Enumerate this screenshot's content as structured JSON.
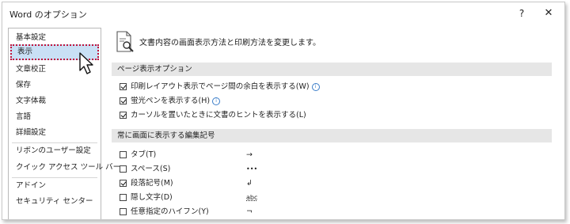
{
  "window": {
    "title": "Word のオプション",
    "help_glyph": "?",
    "close_glyph": "✕"
  },
  "sidebar": {
    "items": [
      {
        "label": "基本設定"
      },
      {
        "label": "表示",
        "selected": true
      },
      {
        "label": "文章校正"
      },
      {
        "label": "保存"
      },
      {
        "label": "文字体裁"
      },
      {
        "label": "言語"
      },
      {
        "label": "詳細設定"
      },
      {
        "label": "リボンのユーザー設定"
      },
      {
        "label": "クイック アクセス ツール バー"
      },
      {
        "label": "アドイン"
      },
      {
        "label": "セキュリティ センター"
      }
    ]
  },
  "main": {
    "header": "文書内容の画面表示方法と印刷方法を変更します。",
    "page_display": {
      "title": "ページ表示オプション",
      "options": [
        {
          "label": "印刷レイアウト表示でページ間の余白を表示する(W)",
          "checked": true,
          "info": true
        },
        {
          "label": "蛍光ペンを表示する(H)",
          "checked": true,
          "info": true
        },
        {
          "label": "カーソルを置いたときに文書のヒントを表示する(L)",
          "checked": true,
          "info": false
        }
      ]
    },
    "formatting_marks": {
      "title": "常に画面に表示する編集記号",
      "options": [
        {
          "label": "タブ(T)",
          "checked": false,
          "symbol": "→"
        },
        {
          "label": "スペース(S)",
          "checked": false,
          "symbol": "•••"
        },
        {
          "label": "段落記号(M)",
          "checked": true,
          "symbol": "↲"
        },
        {
          "label": "隠し文字(D)",
          "checked": false,
          "symbol": "abc"
        },
        {
          "label": "任意指定のハイフン(Y)",
          "checked": false,
          "symbol": "¬"
        }
      ]
    }
  },
  "colors": {
    "selected_bg": "#c9e0f5",
    "selected_outline": "#c0143c",
    "section_bg": "#e6e6e6",
    "info_icon": "#3a7dc9"
  }
}
